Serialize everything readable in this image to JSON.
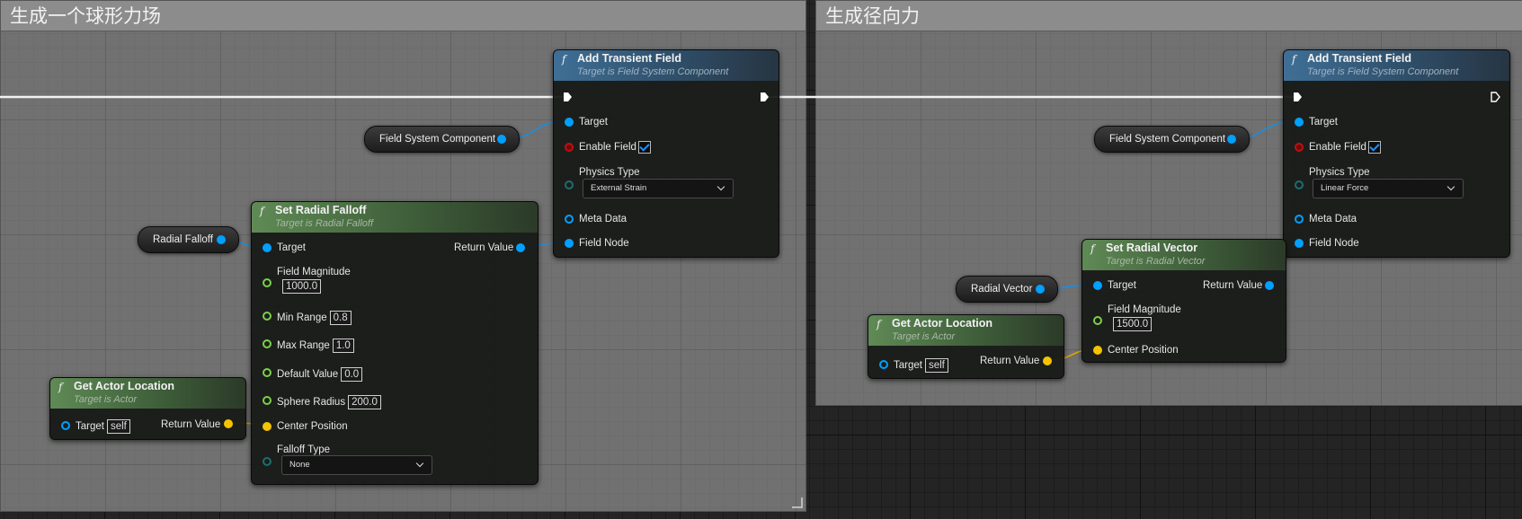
{
  "comments": {
    "left": {
      "title": "生成一个球形力场"
    },
    "right": {
      "title": "生成径向力"
    }
  },
  "colors": {
    "exec": "#ffffff",
    "object_pin": "#00a0ff",
    "float_pin": "#7bd14b",
    "vector_pin": "#f5c400",
    "bool_pin": "#c01010",
    "function_header_blue": "#3f6f96",
    "function_header_green": "#5f8a55"
  },
  "left": {
    "add_transient_field": {
      "func_icon": "f",
      "title": "Add Transient Field",
      "subtitle": "Target is Field System Component",
      "target": "Target",
      "enable_field": "Enable Field",
      "physics_type": "Physics Type",
      "physics_type_value": "External Strain",
      "meta_data": "Meta Data",
      "field_node": "Field Node"
    },
    "field_system_component": "Field System Component",
    "radial_falloff_var": "Radial Falloff",
    "set_radial_falloff": {
      "func_icon": "f",
      "title": "Set Radial Falloff",
      "subtitle": "Target is Radial Falloff",
      "target": "Target",
      "return_value": "Return Value",
      "field_magnitude": "Field Magnitude",
      "field_magnitude_value": "1000.0",
      "min_range": "Min Range",
      "min_range_value": "0.8",
      "max_range": "Max Range",
      "max_range_value": "1.0",
      "default_value": "Default Value",
      "default_value_value": "0.0",
      "sphere_radius": "Sphere Radius",
      "sphere_radius_value": "200.0",
      "center_position": "Center Position",
      "falloff_type": "Falloff Type",
      "falloff_type_value": "None"
    },
    "get_actor_location": {
      "func_icon": "f",
      "title": "Get Actor Location",
      "subtitle": "Target is Actor",
      "target": "Target",
      "target_value": "self",
      "return_value": "Return Value"
    }
  },
  "right": {
    "add_transient_field": {
      "func_icon": "f",
      "title": "Add Transient Field",
      "subtitle": "Target is Field System Component",
      "target": "Target",
      "enable_field": "Enable Field",
      "physics_type": "Physics Type",
      "physics_type_value": "Linear Force",
      "meta_data": "Meta Data",
      "field_node": "Field Node"
    },
    "field_system_component": "Field System Component",
    "radial_vector_var": "Radial Vector",
    "set_radial_vector": {
      "func_icon": "f",
      "title": "Set Radial Vector",
      "subtitle": "Target is Radial Vector",
      "target": "Target",
      "return_value": "Return Value",
      "field_magnitude": "Field Magnitude",
      "field_magnitude_value": "1500.0",
      "center_position": "Center Position"
    },
    "get_actor_location": {
      "func_icon": "f",
      "title": "Get Actor Location",
      "subtitle": "Target is Actor",
      "target": "Target",
      "target_value": "self",
      "return_value": "Return Value"
    }
  }
}
